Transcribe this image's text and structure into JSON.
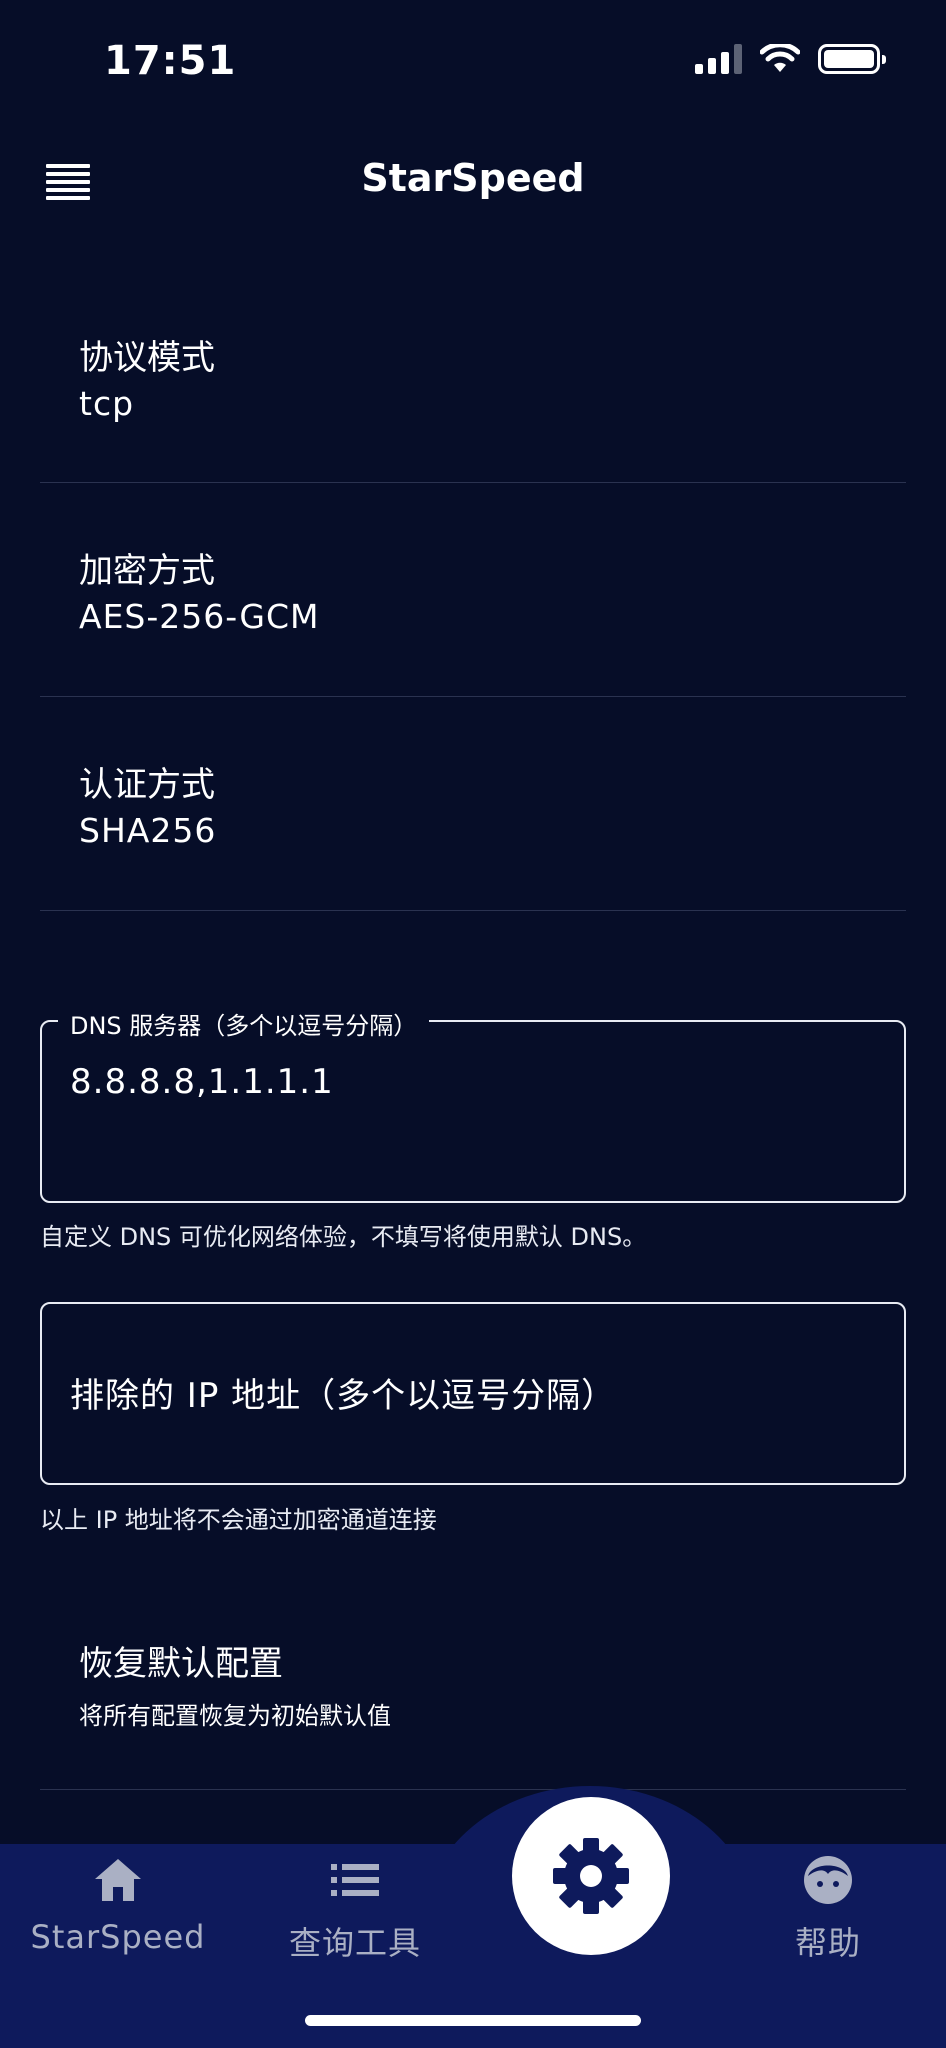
{
  "status_bar": {
    "time": "17:51"
  },
  "header": {
    "title": "StarSpeed"
  },
  "settings": [
    {
      "label": "协议模式",
      "value": "tcp"
    },
    {
      "label": "加密方式",
      "value": "AES-256-GCM"
    },
    {
      "label": "认证方式",
      "value": "SHA256"
    }
  ],
  "dns_field": {
    "legend": "DNS 服务器（多个以逗号分隔）",
    "value": "8.8.8.8,1.1.1.1",
    "helper": "自定义 DNS 可优化网络体验，不填写将使用默认 DNS。"
  },
  "exclude_ip_field": {
    "placeholder": "排除的 IP 地址（多个以逗号分隔）",
    "helper": "以上 IP 地址将不会通过加密通道连接"
  },
  "restore_defaults": {
    "title": "恢复默认配置",
    "subtitle": "将所有配置恢复为初始默认值"
  },
  "bottom_nav": {
    "items": [
      {
        "label": "StarSpeed",
        "icon": "home-icon"
      },
      {
        "label": "查询工具",
        "icon": "list-icon"
      },
      {
        "label": "",
        "icon": "gear-icon",
        "active": true
      },
      {
        "label": "帮助",
        "icon": "face-icon"
      }
    ]
  },
  "colors": {
    "background": "#060d28",
    "nav_background": "#0e1a5c",
    "nav_inactive": "#aab0c4",
    "accent": "#ffffff"
  }
}
